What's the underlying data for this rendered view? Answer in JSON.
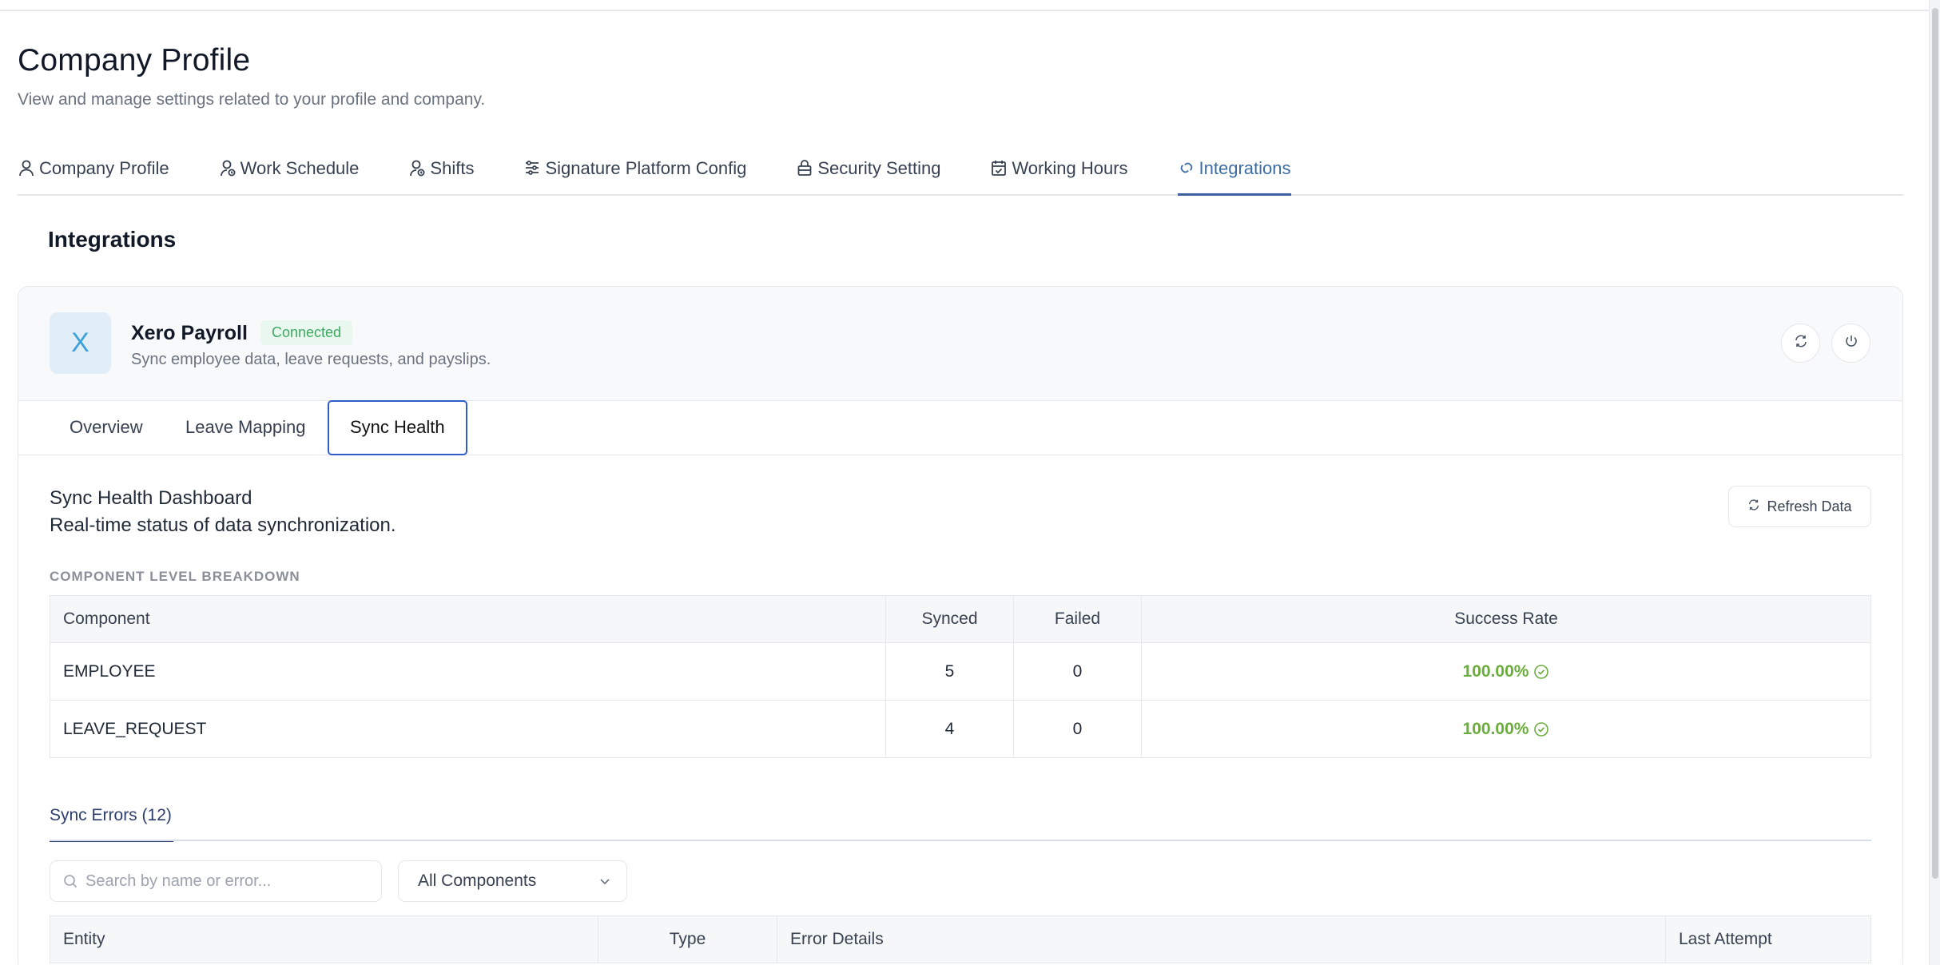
{
  "page": {
    "title": "Company Profile",
    "subtitle": "View and manage settings related to your profile and company."
  },
  "main_tabs": [
    {
      "label": "Company Profile",
      "icon": "user-icon"
    },
    {
      "label": "Work Schedule",
      "icon": "user-clock-icon"
    },
    {
      "label": "Shifts",
      "icon": "user-clock-icon"
    },
    {
      "label": "Signature Platform Config",
      "icon": "sliders-icon"
    },
    {
      "label": "Security Setting",
      "icon": "lock-icon"
    },
    {
      "label": "Working Hours",
      "icon": "calendar-check-icon"
    },
    {
      "label": "Integrations",
      "icon": "link-icon",
      "active": true
    }
  ],
  "section": {
    "title": "Integrations"
  },
  "integration": {
    "logo_letter": "X",
    "name": "Xero Payroll",
    "status": "Connected",
    "description": "Sync employee data, leave requests, and payslips."
  },
  "sub_tabs": [
    {
      "label": "Overview"
    },
    {
      "label": "Leave Mapping"
    },
    {
      "label": "Sync Health",
      "active": true
    }
  ],
  "dashboard": {
    "title": "Sync Health Dashboard",
    "subtitle": "Real-time status of data synchronization.",
    "refresh_label": "Refresh Data",
    "breakdown_label": "COMPONENT LEVEL BREAKDOWN"
  },
  "breakdown_table": {
    "headers": [
      "Component",
      "Synced",
      "Failed",
      "Success Rate"
    ],
    "rows": [
      {
        "component": "EMPLOYEE",
        "synced": "5",
        "failed": "0",
        "rate": "100.00%"
      },
      {
        "component": "LEAVE_REQUEST",
        "synced": "4",
        "failed": "0",
        "rate": "100.00%"
      }
    ]
  },
  "errors": {
    "tab_label": "Sync Errors (12)",
    "search_placeholder": "Search by name or error...",
    "filter_value": "All Components",
    "headers": [
      "Entity",
      "Type",
      "Error Details",
      "Last Attempt"
    ]
  },
  "colors": {
    "accent": "#3b6ea5",
    "success": "#6aad3c",
    "badge_bg": "#eaf7ee",
    "badge_text": "#3ea864",
    "logo_text": "#3ba0da"
  }
}
